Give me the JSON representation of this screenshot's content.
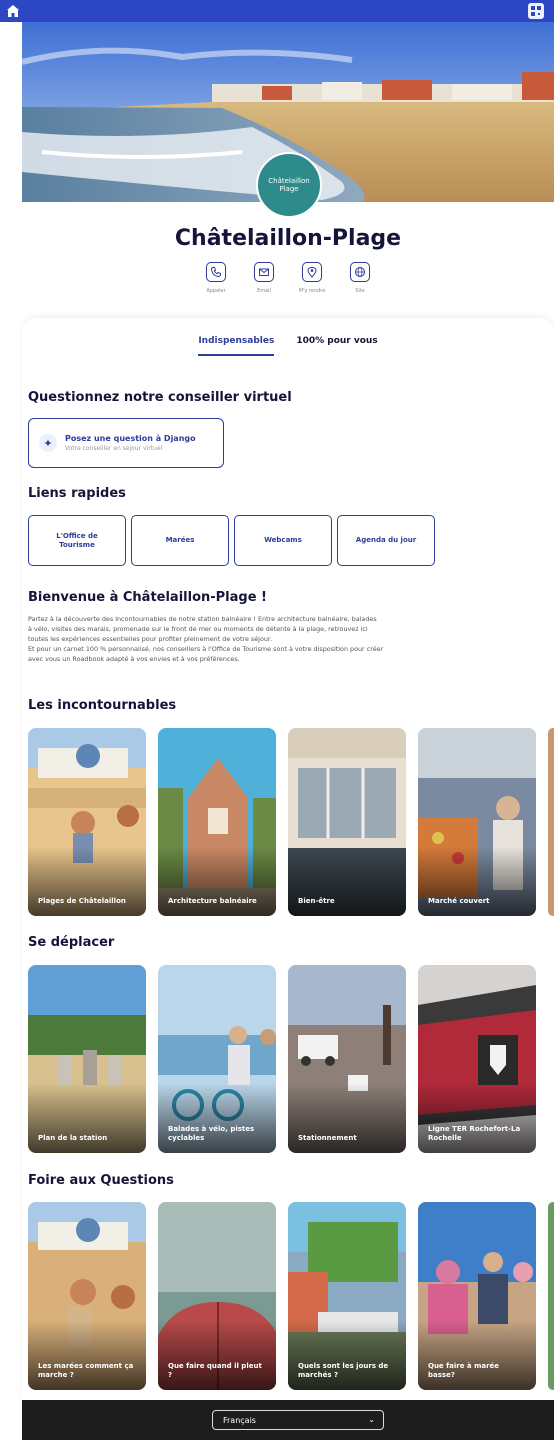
{
  "header": {
    "home_icon": "home-icon",
    "camera_icon": "qr-icon"
  },
  "hero": {
    "logo_line1": "Châtelaillon",
    "logo_line2": "Plage"
  },
  "title": "Châtelaillon-Plage",
  "contacts": [
    {
      "label": "Appeler",
      "icon": "phone-icon"
    },
    {
      "label": "Email",
      "icon": "mail-icon"
    },
    {
      "label": "M'y rendre",
      "icon": "map-pin-icon"
    },
    {
      "label": "Site",
      "icon": "globe-icon"
    }
  ],
  "tabs": [
    "Indispensables",
    "100% pour vous"
  ],
  "assistant": {
    "heading": "Questionnez notre conseiller virtuel",
    "button_title": "Posez une question à Django",
    "button_subtitle": "Votre conseiller en séjour virtuel"
  },
  "quick_links": {
    "heading": "Liens rapides",
    "items": [
      "L'Office de Tourisme",
      "Marées",
      "Webcams",
      "Agenda du jour"
    ]
  },
  "welcome": {
    "heading": "Bienvenue à Châtelaillon-Plage !",
    "line1": "Partez à la découverte des incontournables de notre station balnéaire ! Entre architecture balnéaire, balades",
    "line2": "à vélo, visites des marais, promenade sur le front de mer ou moments de détente à la plage, retrouvez ici",
    "line3": "toutes les expériences essentielles pour profiter pleinement de votre séjour.",
    "line4": "Et pour un carnet 100 % personnalisé, nos conseillers à l'Office de Tourisme sont à votre disposition pour créer",
    "line5": "avec vous un Roadbook adapté à vos envies et à vos préférences."
  },
  "incontournables": {
    "heading": "Les incontournables",
    "cards": [
      "Plages de Châtelaillon",
      "Architecture balnéaire",
      "Bien-être",
      "Marché couvert"
    ]
  },
  "deplacer": {
    "heading": "Se déplacer",
    "cards": [
      "Plan de la station",
      "Balades à vélo, pistes cyclables",
      "Stationnement",
      "Ligne TER Rochefort-La Rochelle"
    ]
  },
  "faq": {
    "heading": "Foire aux Questions",
    "cards": [
      "Les marées comment ça marche ?",
      "Que faire quand il pleut ?",
      "Quels sont les jours de marchés ?",
      "Que faire à marée basse?"
    ]
  },
  "footer": {
    "language": "Français"
  },
  "colors": {
    "accent": "#2d3d9a",
    "topbar": "#2d46c4",
    "logo": "#2d8b8b",
    "footer": "#1d1d1d"
  }
}
